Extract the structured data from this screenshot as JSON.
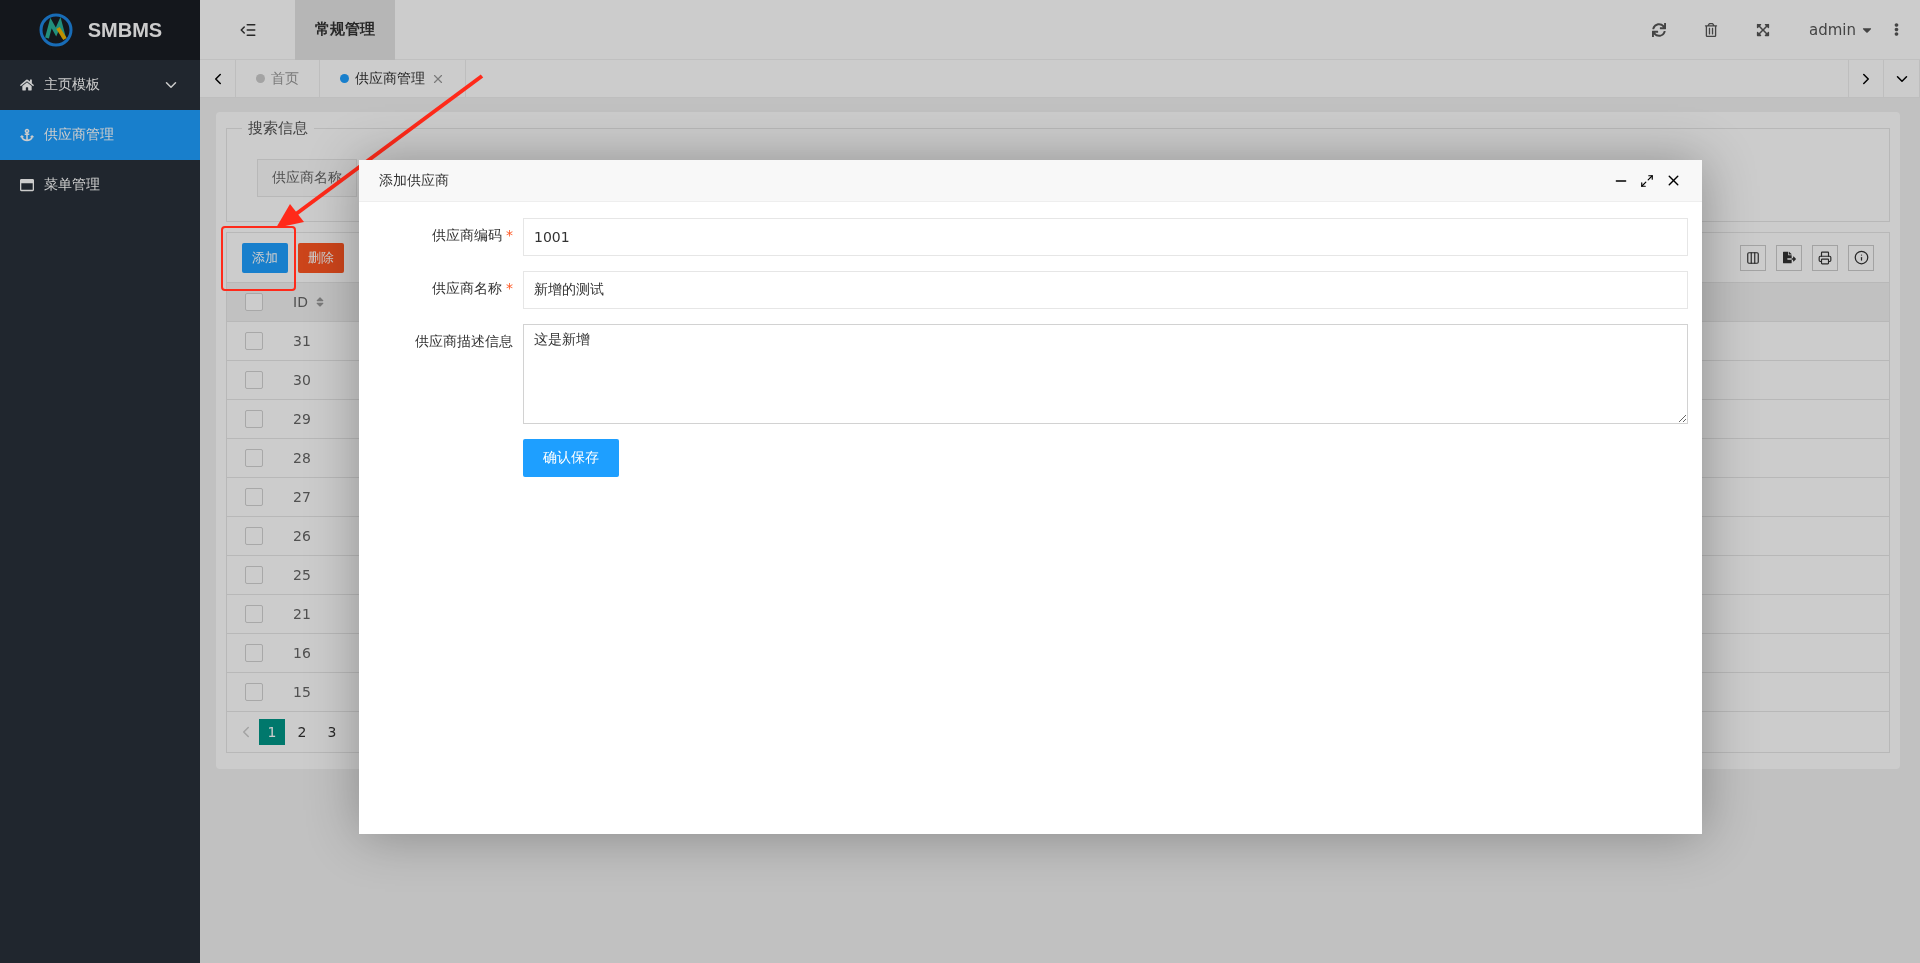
{
  "app": {
    "logo_text": "SMBMS"
  },
  "header": {
    "nav": [
      {
        "label": "常规管理",
        "selected": true
      }
    ],
    "user": "admin"
  },
  "sidebar": {
    "items": [
      {
        "label": "主页模板",
        "selected": false,
        "has_children": true
      },
      {
        "label": "供应商管理",
        "selected": true,
        "has_children": false
      },
      {
        "label": "菜单管理",
        "selected": false,
        "has_children": false
      }
    ]
  },
  "tabs": [
    {
      "label": "首页",
      "selected": false,
      "closable": false
    },
    {
      "label": "供应商管理",
      "selected": true,
      "closable": true
    }
  ],
  "search": {
    "legend": "搜索信息",
    "label": "供应商名称"
  },
  "toolbar": {
    "buttons": [
      {
        "label": "添加",
        "kind": "primary"
      },
      {
        "label": "删除",
        "kind": "danger"
      }
    ]
  },
  "table": {
    "header_checked": false,
    "columns": [
      {
        "label": "ID",
        "sortable": true
      }
    ],
    "rows": [
      {
        "id": "31",
        "checked": false
      },
      {
        "id": "30",
        "checked": false
      },
      {
        "id": "29",
        "checked": false
      },
      {
        "id": "28",
        "checked": false
      },
      {
        "id": "27",
        "checked": false
      },
      {
        "id": "26",
        "checked": false
      },
      {
        "id": "25",
        "checked": false
      },
      {
        "id": "21",
        "checked": false
      },
      {
        "id": "16",
        "checked": false
      },
      {
        "id": "15",
        "checked": false
      }
    ]
  },
  "pagination": {
    "pages": [
      {
        "label": "1",
        "selected": true
      },
      {
        "label": "2",
        "selected": false
      },
      {
        "label": "3",
        "selected": false
      }
    ]
  },
  "dialog": {
    "title": "添加供应商",
    "fields": [
      {
        "kind": "input",
        "label": "供应商编码",
        "marker": "*",
        "value": "1001"
      },
      {
        "kind": "input",
        "label": "供应商名称",
        "marker": "*",
        "value": "新增的测试"
      },
      {
        "kind": "textarea",
        "label": "供应商描述信息",
        "value": "这是新增"
      }
    ],
    "submit": "确认保存"
  }
}
